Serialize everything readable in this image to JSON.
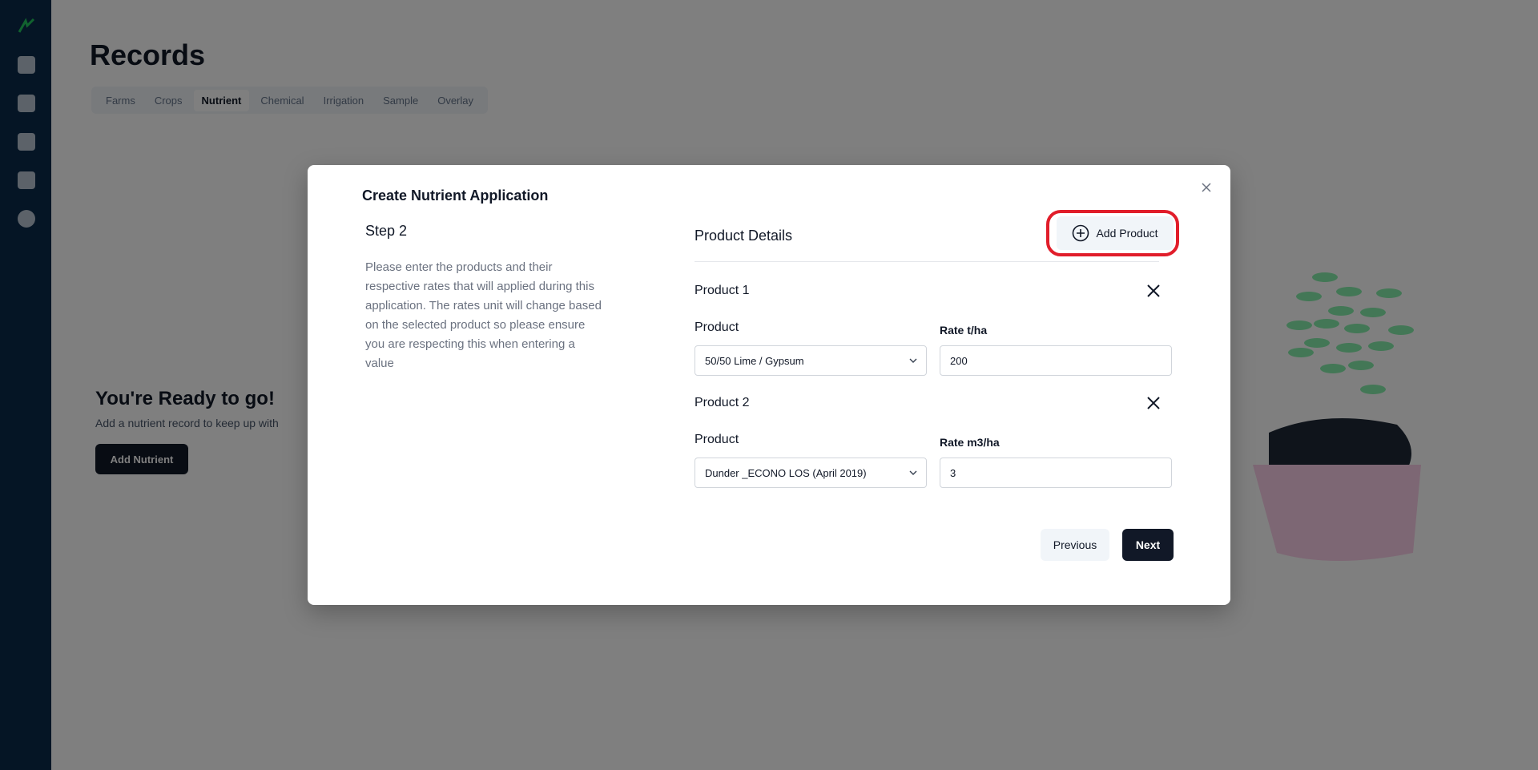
{
  "background": {
    "page_title": "Records",
    "tabs": [
      "Farms",
      "Crops",
      "Nutrient",
      "Chemical",
      "Irrigation",
      "Sample",
      "Overlay"
    ],
    "active_tab": "Nutrient",
    "empty_title": "You're Ready to go!",
    "empty_subtitle": "Add a nutrient record to keep up with",
    "empty_button": "Add Nutrient"
  },
  "sidebar": {
    "icons": [
      "logo-icon",
      "grid-icon",
      "document-icon",
      "monitor-icon",
      "folder-icon",
      "settings-icon"
    ]
  },
  "modal": {
    "title": "Create Nutrient Application",
    "step_title": "Step 2",
    "step_description": "Please enter the products and their respective rates that will applied during this application. The rates unit will change based on the selected product so please ensure you are respecting this when entering a value",
    "details_title": "Product Details",
    "add_product_label": "Add Product",
    "products": [
      {
        "label": "Product 1",
        "product_field_label": "Product",
        "product_value": "50/50 Lime / Gypsum",
        "rate_label": "Rate t/ha",
        "rate_value": "200"
      },
      {
        "label": "Product 2",
        "product_field_label": "Product",
        "product_value": "Dunder _ECONO LOS (April 2019)",
        "rate_label": "Rate m3/ha",
        "rate_value": "3"
      }
    ],
    "previous_label": "Previous",
    "next_label": "Next"
  },
  "colors": {
    "sidebar": "#0b2a4a",
    "primary_button": "#111827",
    "highlight": "#e11d2a",
    "overlay": "rgba(0,0,0,0.5)"
  }
}
